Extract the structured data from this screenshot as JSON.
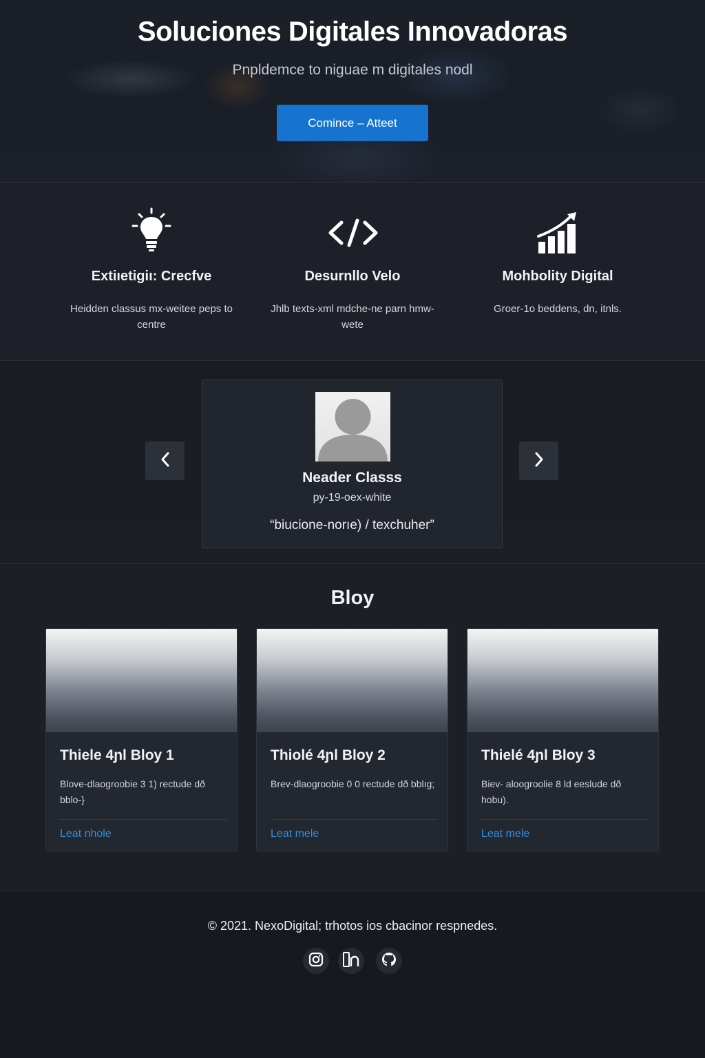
{
  "hero": {
    "title": "Soluciones Digitales Innovadoras",
    "subtitle": "Pnpldemce to niguae m digitales nodl",
    "cta_label": "Comince – Atteet"
  },
  "features": [
    {
      "icon": "lightbulb-icon",
      "title": "Extiıetigiı: Crecfve",
      "description": "Heidden classus mx-weitee peps to centre"
    },
    {
      "icon": "code-icon",
      "title": "Desurnllo Velo",
      "description": "Jhlb texts-xml mdche-ne parn hmw-wete"
    },
    {
      "icon": "bar-chart-icon",
      "title": "Mohbolity Digital",
      "description": "Groer-1o beddens, dn, itnls."
    }
  ],
  "testimonial": {
    "name": "Neader Classs",
    "role": "py-19-oex-white",
    "quote": "“biucione-norıe) / texchuher”",
    "prev_icon": "chevron-left-icon",
    "next_icon": "chevron-right-icon"
  },
  "blog": {
    "title": "Bloy",
    "posts": [
      {
        "title": "Thiele 4ɲl Bloy 1",
        "excerpt": "Blove-dlaogroobie 3 1) rectude dð bblo-}",
        "link": "Leat nhole"
      },
      {
        "title": "Thiolé 4ɲl Bloy 2",
        "excerpt": "Brev-dlaogroobie 0 0 rectude dð bblıg;",
        "link": "Leat mele"
      },
      {
        "title": "Thielé 4ɲl Bloy 3",
        "excerpt": "Biev- aloogroolie 8 ld eeslude dð hobu).",
        "link": "Leat mele"
      }
    ]
  },
  "footer": {
    "copyright": "© 2021. NexoDigital; trhotos ios cbacinor respnedes.",
    "socials": [
      "instagram-icon",
      "linkedin-icon",
      "github-icon"
    ]
  },
  "colors": {
    "accent": "#1673d0",
    "link": "#2f8fe3",
    "background": "#16181d",
    "card": "#232730"
  }
}
